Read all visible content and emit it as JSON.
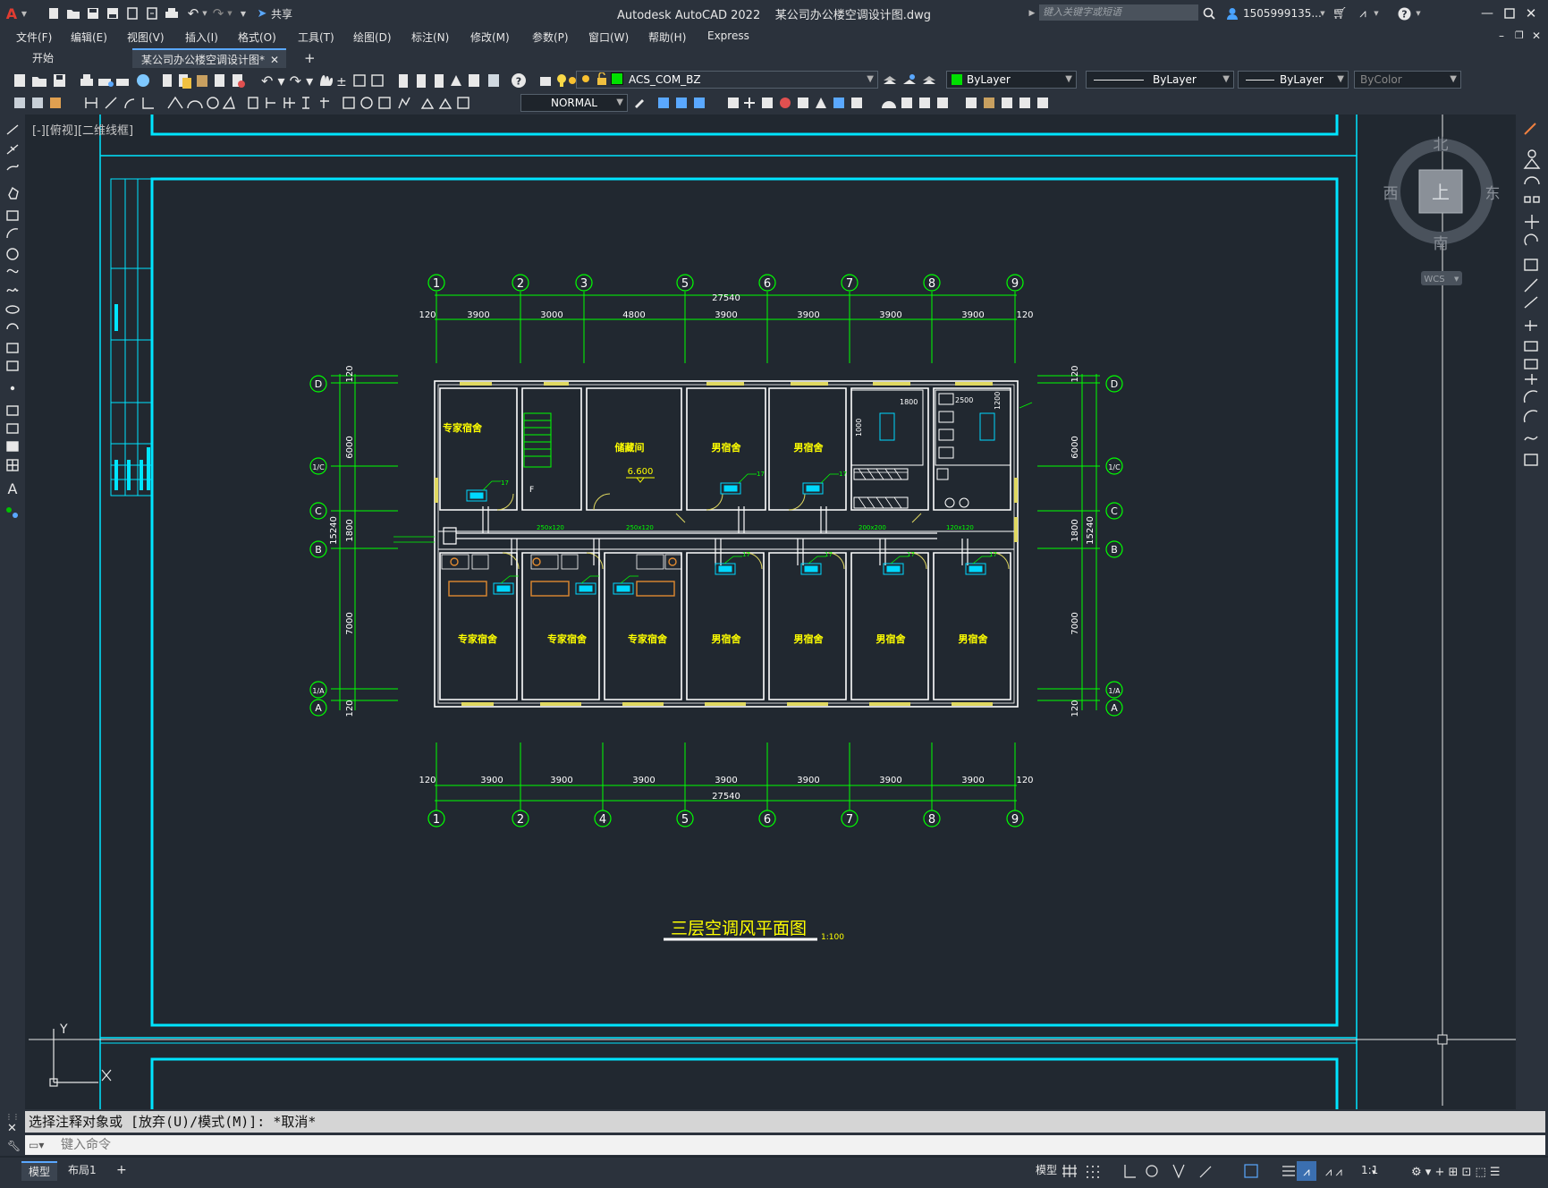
{
  "titlebar": {
    "app_title": "Autodesk AutoCAD 2022",
    "file_name": "某公司办公楼空调设计图.dwg",
    "share_label": "共享",
    "search_placeholder": "键入关键字或短语",
    "user_name": "1505999135...",
    "logo": "A"
  },
  "menus": [
    "文件(F)",
    "编辑(E)",
    "视图(V)",
    "插入(I)",
    "格式(O)",
    "工具(T)",
    "绘图(D)",
    "标注(N)",
    "修改(M)",
    "参数(P)",
    "窗口(W)",
    "帮助(H)",
    "Express"
  ],
  "tabs": {
    "start": "开始",
    "active": "某公司办公楼空调设计图*"
  },
  "toolbar": {
    "layer_name": "ACS_COM_BZ",
    "color": "ByLayer",
    "linetype": "ByLayer",
    "lineweight": "ByLayer",
    "plotstyle": "ByColor",
    "dimstyle": "NORMAL"
  },
  "viewport": {
    "label": "[-][俯视][二维线框]",
    "viewcube": {
      "top": "上",
      "north": "北",
      "south": "南",
      "east": "东",
      "west": "西",
      "wcs": "WCS"
    }
  },
  "drawing": {
    "title": "三层空调风平面图",
    "scale": "1:100",
    "top_axes": [
      "1",
      "2",
      "3",
      "5",
      "6",
      "7",
      "8",
      "9"
    ],
    "top_dims": [
      "3900",
      "3000",
      "4800",
      "3900",
      "3900",
      "3900",
      "3900"
    ],
    "bottom_axes": [
      "1",
      "2",
      "4",
      "5",
      "6",
      "7",
      "8",
      "9"
    ],
    "bottom_dims": [
      "3900",
      "3900",
      "3900",
      "3900",
      "3900",
      "3900",
      "3900"
    ],
    "overall_dim": "27540",
    "edge_dim": "120",
    "left_axes": [
      "D",
      "1/C",
      "C",
      "B",
      "1/A",
      "A"
    ],
    "left_dims": [
      "120",
      "6000",
      "1800",
      "7000",
      "120"
    ],
    "overall_vertical": "15240",
    "rooms_top": [
      "专家宿舍",
      "储藏间",
      "男宿舍",
      "男宿舍"
    ],
    "rooms_bottom": [
      "专家宿舍",
      "专家宿舍",
      "专家宿舍",
      "男宿舍",
      "男宿舍",
      "男宿舍",
      "男宿舍"
    ],
    "elevation": "6.600",
    "stair_label": "F",
    "toilet_dims": [
      "1800",
      "2500",
      "1000",
      "1200"
    ],
    "duct_labels": [
      "250x120",
      "200x200",
      "120x120"
    ],
    "terminal_num": "17"
  },
  "command": {
    "last": "选择注释对象或 [放弃(U)/模式(M)]: *取消*",
    "placeholder": "键入命令"
  },
  "status": {
    "model_tab": "模型",
    "layout_tab": "布局1",
    "model_button": "模型",
    "scale": "1:1"
  },
  "ucs": {
    "x": "X",
    "y": "Y"
  },
  "colors": {
    "accent": "#00e5ff",
    "green": "#00ff00",
    "yellow": "#ffff00",
    "background": "#212830"
  }
}
